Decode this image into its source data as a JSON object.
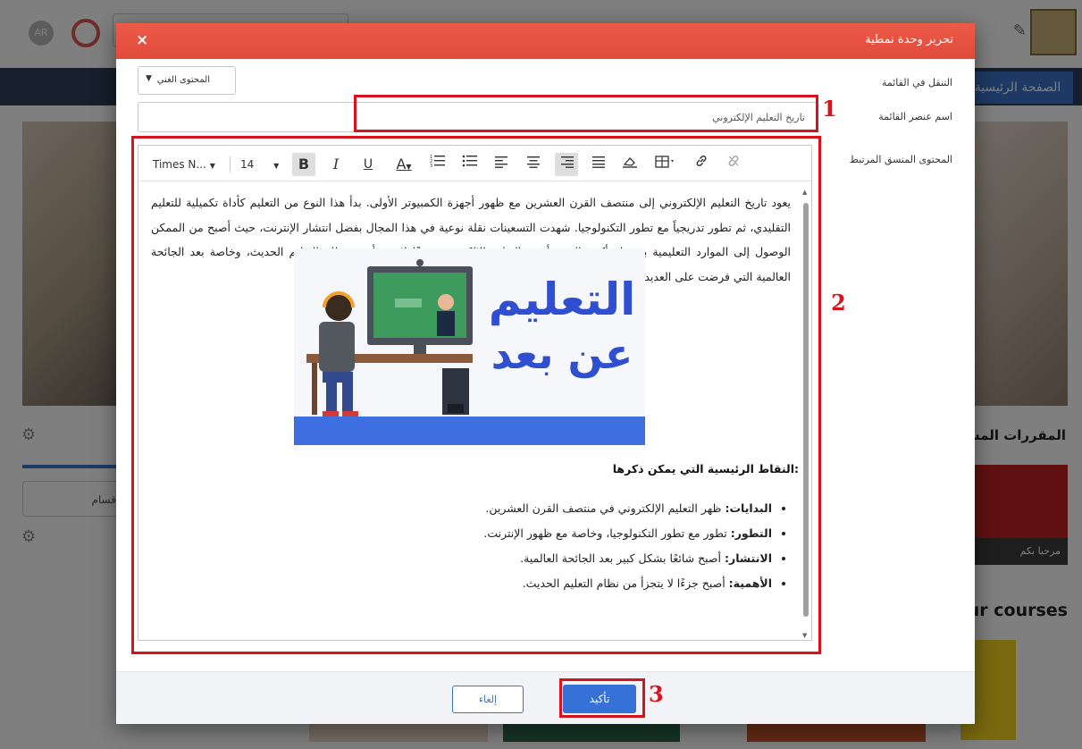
{
  "background": {
    "avatar_initials": "AR",
    "nav_home": "الصفحة الرئيسية",
    "shared_courses_title": "المقررات المشتر",
    "card_caption": "مرحبا بكم",
    "courses_title": "ur courses",
    "select_partial": "قسام"
  },
  "modal": {
    "title": "تحرير وحدة نمطية",
    "close_icon": "×",
    "nav_label": "التنقل في القائمة",
    "nav_select_value": "المحتوى الغني",
    "name_label": "اسم عنصر القائمة",
    "name_value": "تاريخ التعليم الإلكتروني",
    "content_label": "المحتوى المنسق المرتبط",
    "toolbar": {
      "font": "Times N...",
      "size": "14"
    },
    "editor": {
      "paragraph": "يعود تاريخ التعليم الإلكتروني إلى منتصف القرن العشرين مع ظهور أجهزة الكمبيوتر الأولى. بدأ هذا النوع من التعليم كأداة تكميلية للتعليم التقليدي، ثم تطور تدريجياً مع تطور التكنولوجيا. شهدت التسعينات نقلة نوعية في هذا المجال بفضل انتشار الإنترنت، حيث أصبح من الممكن الوصول إلى الموارد التعليمية بسهولة أكبر. اليوم، أصبح التعليم الإلكتروني جزءًا لا يتجزأ من نظام التعليم الحديث، وخاصة بعد الجائحة العالمية التي فرضت على العديد من المؤسسات التعليمية التحول إلى التعلم عن بعد.",
      "hero_text_1": "التعليم",
      "hero_text_2": "عن بعد",
      "points_title": "النقاط الرئيسية التي يمكن ذكرها:",
      "points": [
        {
          "term": "البدايات:",
          "text": "ظهر التعليم الإلكتروني في منتصف القرن العشرين."
        },
        {
          "term": "التطور:",
          "text": "تطور مع تطور التكنولوجيا، وخاصة مع ظهور الإنترنت."
        },
        {
          "term": "الانتشار:",
          "text": "أصبح شائعًا بشكل كبير بعد الجائحة العالمية."
        },
        {
          "term": "الأهمية:",
          "text": "أصبح جزءًا لا يتجزأ من نظام التعليم الحديث."
        }
      ]
    },
    "cancel_label": "إلغاء",
    "confirm_label": "تأكيد"
  },
  "annotations": [
    "1",
    "2",
    "3"
  ],
  "colors": {
    "header_red": "#e04b3b",
    "primary_blue": "#3571d6",
    "annotation_red": "#d9131b"
  }
}
